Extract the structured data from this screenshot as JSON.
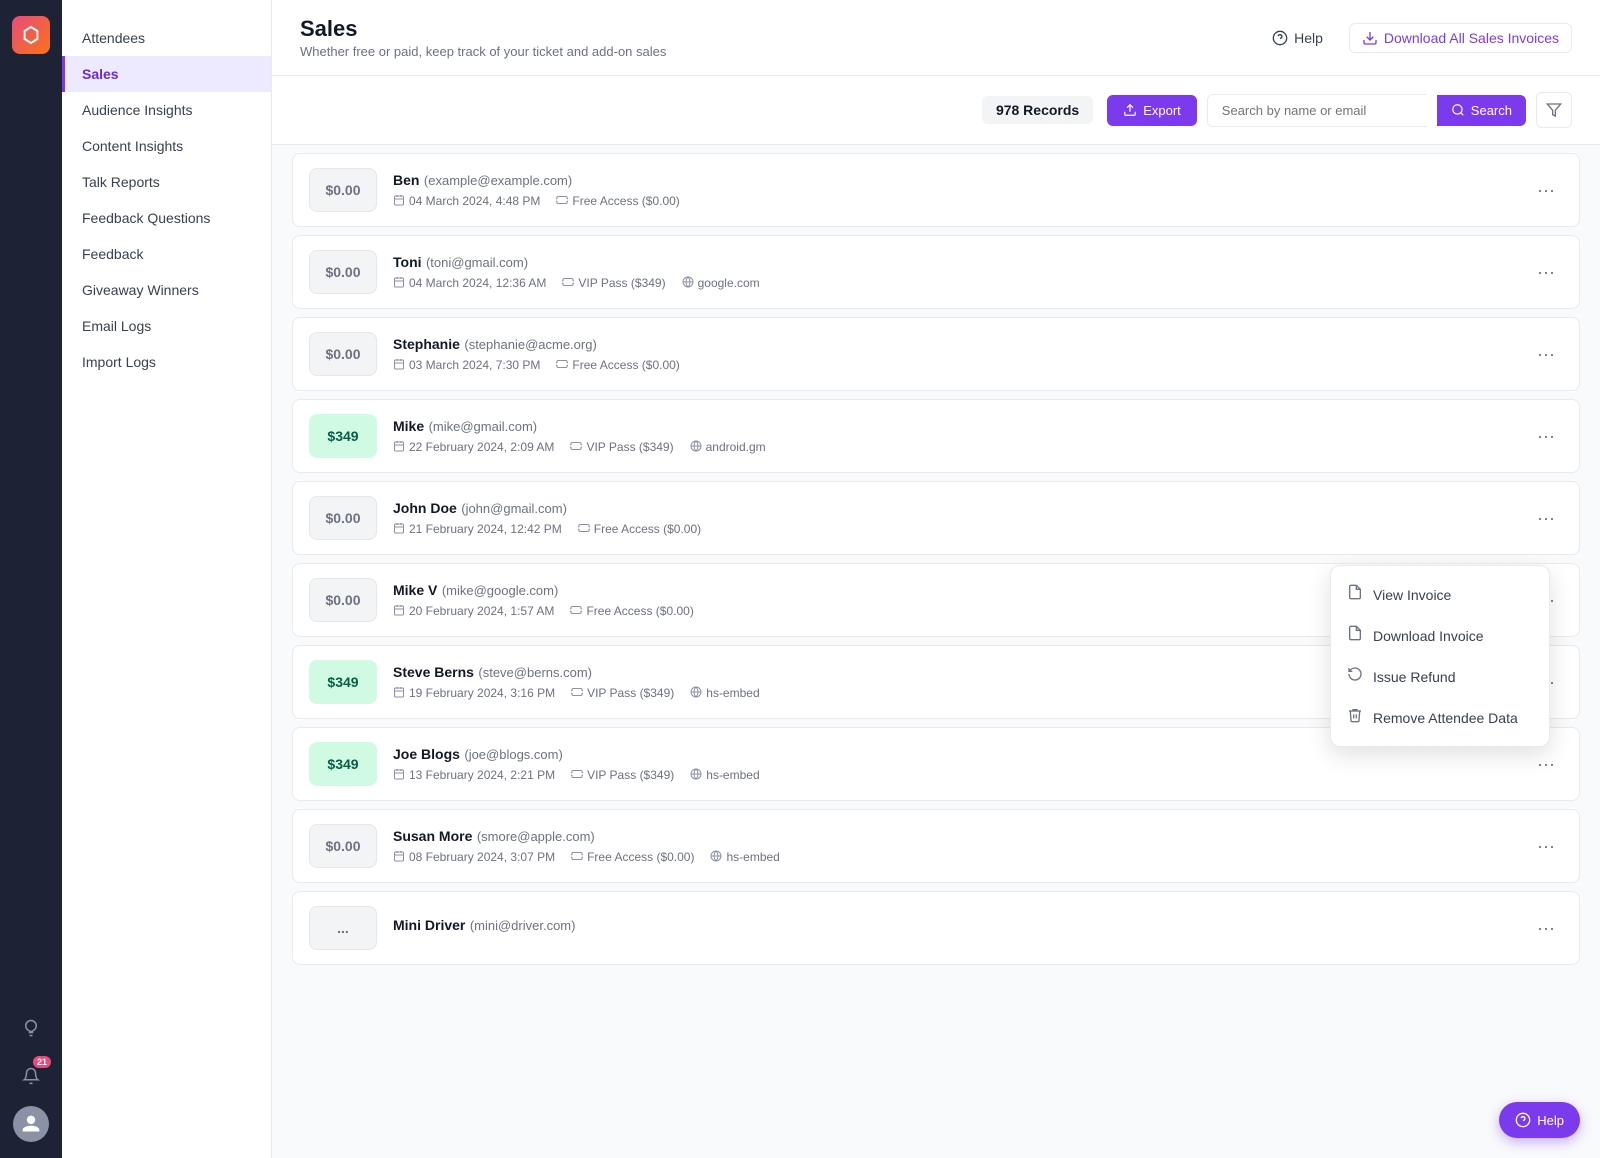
{
  "app": {
    "logo_alt": "App Logo"
  },
  "sidebar_dark": {
    "notification_count": "21"
  },
  "nav": {
    "items": [
      {
        "id": "attendees",
        "label": "Attendees",
        "active": false
      },
      {
        "id": "sales",
        "label": "Sales",
        "active": true
      },
      {
        "id": "audience-insights",
        "label": "Audience Insights",
        "active": false
      },
      {
        "id": "content-insights",
        "label": "Content Insights",
        "active": false
      },
      {
        "id": "talk-reports",
        "label": "Talk Reports",
        "active": false
      },
      {
        "id": "feedback-questions",
        "label": "Feedback Questions",
        "active": false
      },
      {
        "id": "feedback",
        "label": "Feedback",
        "active": false
      },
      {
        "id": "giveaway-winners",
        "label": "Giveaway Winners",
        "active": false
      },
      {
        "id": "email-logs",
        "label": "Email Logs",
        "active": false
      },
      {
        "id": "import-logs",
        "label": "Import Logs",
        "active": false
      }
    ]
  },
  "header": {
    "title": "Sales",
    "subtitle": "Whether free or paid, keep track of your ticket and add-on sales",
    "help_label": "Help",
    "download_all_label": "Download All Sales Invoices"
  },
  "toolbar": {
    "records_count": "978 Records",
    "export_label": "Export",
    "search_placeholder": "Search by name or email",
    "search_label": "Search"
  },
  "records": [
    {
      "name": "Ben",
      "email": "example@example.com",
      "amount": "$0.00",
      "paid": false,
      "date": "04 March 2024, 4:48 PM",
      "ticket": "Free Access ($0.00)",
      "source": ""
    },
    {
      "name": "Toni",
      "email": "toni@gmail.com",
      "amount": "$0.00",
      "paid": true,
      "amount_display": "$0.00",
      "date": "04 March 2024, 12:36 AM",
      "ticket": "VIP Pass ($349)",
      "source": "google.com"
    },
    {
      "name": "Stephanie",
      "email": "stephanie@acme.org",
      "amount": "$0.00",
      "paid": false,
      "date": "03 March 2024, 7:30 PM",
      "ticket": "Free Access ($0.00)",
      "source": ""
    },
    {
      "name": "Mike",
      "email": "mike@gmail.com",
      "amount": "$349",
      "paid": true,
      "date": "22 February 2024, 2:09 AM",
      "ticket": "VIP Pass ($349)",
      "source": "android.gm"
    },
    {
      "name": "John Doe",
      "email": "john@gmail.com",
      "amount": "$0.00",
      "paid": false,
      "date": "21 February 2024, 12:42 PM",
      "ticket": "Free Access ($0.00)",
      "source": ""
    },
    {
      "name": "Mike V",
      "email": "mike@google.com",
      "amount": "$0.00",
      "paid": false,
      "date": "20 February 2024, 1:57 AM",
      "ticket": "Free Access ($0.00)",
      "source": ""
    },
    {
      "name": "Steve Berns",
      "email": "steve@berns.com",
      "amount": "$349",
      "paid": true,
      "date": "19 February 2024, 3:16 PM",
      "ticket": "VIP Pass ($349)",
      "source": "hs-embed"
    },
    {
      "name": "Joe Blogs",
      "email": "joe@blogs.com",
      "amount": "$349",
      "paid": true,
      "date": "13 February 2024, 2:21 PM",
      "ticket": "VIP Pass ($349)",
      "source": "hs-embed"
    },
    {
      "name": "Susan More",
      "email": "smore@apple.com",
      "amount": "$0.00",
      "paid": false,
      "date": "08 February 2024, 3:07 PM",
      "ticket": "Free Access ($0.00)",
      "source": "hs-embed"
    },
    {
      "name": "Mini Driver",
      "email": "mini@driver.com",
      "amount": "...",
      "paid": false,
      "date": "",
      "ticket": "",
      "source": ""
    }
  ],
  "dropdown": {
    "items": [
      {
        "id": "view-invoice",
        "label": "View Invoice",
        "icon": "📄"
      },
      {
        "id": "download-invoice",
        "label": "Download Invoice",
        "icon": "📄"
      },
      {
        "id": "issue-refund",
        "label": "Issue Refund",
        "icon": "↩"
      },
      {
        "id": "remove-attendee",
        "label": "Remove Attendee Data",
        "icon": "🗑"
      }
    ]
  },
  "help_float": {
    "label": "Help"
  }
}
